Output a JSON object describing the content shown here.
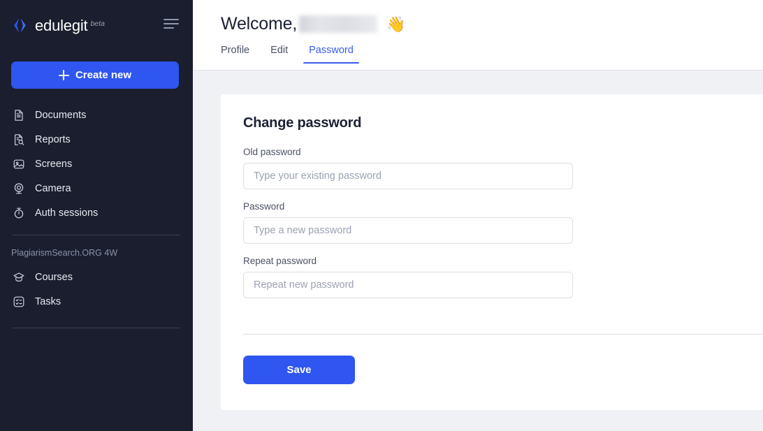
{
  "sidebar": {
    "brand": {
      "name": "edulegit",
      "badge": "beta",
      "logo_icon": "edulegit-star-logo"
    },
    "menu_toggle_icon": "hamburger-menu-icon",
    "create_button": {
      "label": "Create new",
      "icon": "plus-icon",
      "color": "#2f56f0"
    },
    "nav_items": [
      {
        "label": "Documents",
        "icon": "document-icon"
      },
      {
        "label": "Reports",
        "icon": "report-search-icon"
      },
      {
        "label": "Screens",
        "icon": "image-screen-icon"
      },
      {
        "label": "Camera",
        "icon": "webcam-icon"
      },
      {
        "label": "Auth sessions",
        "icon": "stopwatch-icon"
      }
    ],
    "section_label": "PlagiarismSearch.ORG 4W",
    "section_items": [
      {
        "label": "Courses",
        "icon": "graduation-cap-icon"
      },
      {
        "label": "Tasks",
        "icon": "checklist-icon"
      }
    ],
    "background_color": "#1a1e2e"
  },
  "header": {
    "welcome_text": "Welcome,",
    "username_redacted": "",
    "wave_emoji": "👋",
    "tabs": [
      {
        "label": "Profile",
        "active": false
      },
      {
        "label": "Edit",
        "active": false
      },
      {
        "label": "Password",
        "active": true
      }
    ],
    "active_tab_color": "#3b5bf0"
  },
  "main": {
    "card_title": "Change password",
    "fields": [
      {
        "label": "Old password",
        "placeholder": "Type your existing password",
        "value": ""
      },
      {
        "label": "Password",
        "placeholder": "Type a new password",
        "value": ""
      },
      {
        "label": "Repeat password",
        "placeholder": "Repeat new password",
        "value": ""
      }
    ],
    "save_button": {
      "label": "Save",
      "color": "#2f56f0"
    }
  }
}
